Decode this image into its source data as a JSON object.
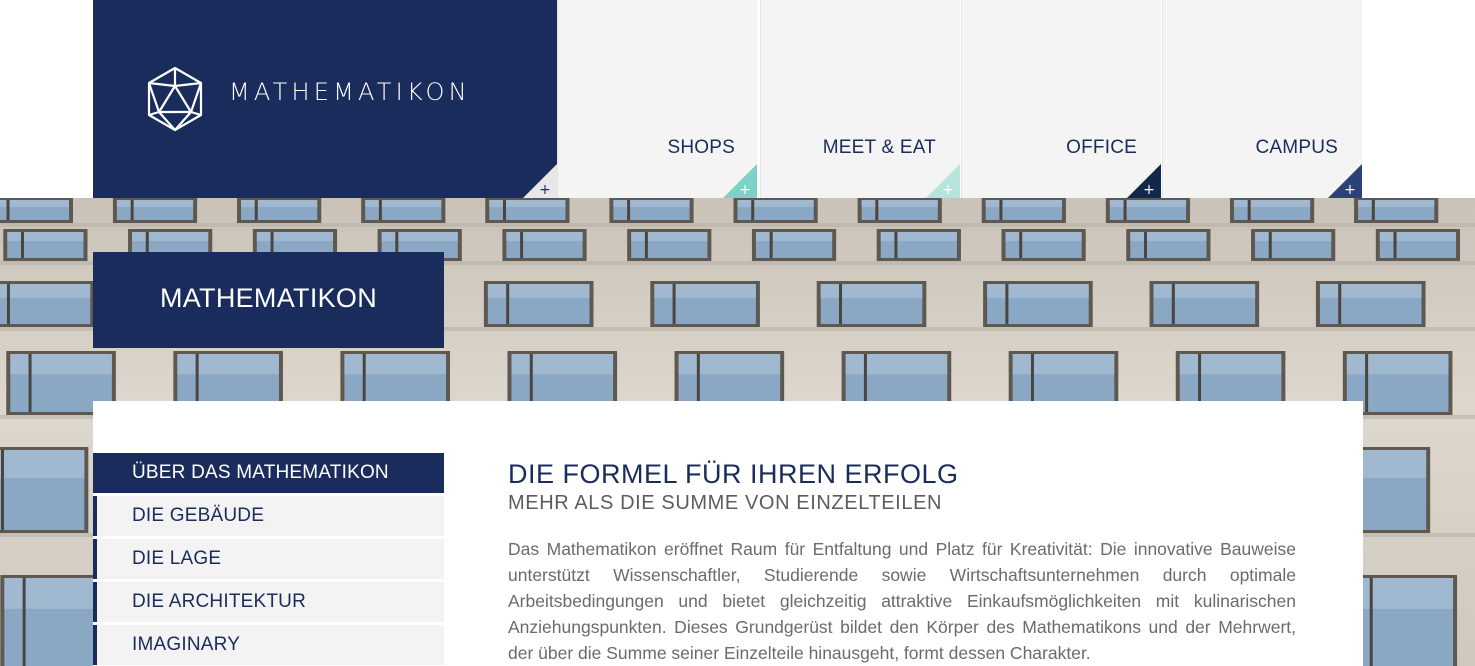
{
  "brand": {
    "logo_text": "MATHEMATIKON",
    "logo_icon": "icosahedron-icon"
  },
  "nav": [
    {
      "label": "SHOPS",
      "accent": "#7fd1c8"
    },
    {
      "label": "MEET & EAT",
      "accent": "#b6e4dd"
    },
    {
      "label": "OFFICE",
      "accent": "#132849"
    },
    {
      "label": "CAMPUS",
      "accent": "#2a4277"
    }
  ],
  "page_title": "MATHEMATIKON",
  "subnav": [
    {
      "label": "ÜBER DAS MATHEMATIKON",
      "active": true
    },
    {
      "label": "DIE GEBÄUDE",
      "active": false
    },
    {
      "label": "DIE LAGE",
      "active": false
    },
    {
      "label": "DIE ARCHITEKTUR",
      "active": false
    },
    {
      "label": "IMAGINARY",
      "active": false
    }
  ],
  "article": {
    "heading": "DIE FORMEL FÜR IHREN ERFOLG",
    "subheading": "MEHR ALS DIE SUMME VON EINZELTEILEN",
    "body": "Das Mathematikon eröffnet Raum für Entfaltung und Platz für Kreativität: Die innovative Bauweise unterstützt Wissenschaftler, Studierende sowie Wirtschaftsunternehmen durch optimale Arbeitsbedingungen und bietet gleichzeitig attraktive Einkaufsmöglichkeiten mit kulinarischen Anziehungspunkten. Dieses Grundgerüst bildet den Körper des Mathematikons und der Mehrwert, der über die Summe seiner Einzelteile hinausgeht, formt dessen Charakter."
  },
  "colors": {
    "brand_navy": "#1a2c5b",
    "nav_bg": "#f4f4f4",
    "text_grey": "#6b6b6b"
  },
  "corner_icon": "plus-icon"
}
